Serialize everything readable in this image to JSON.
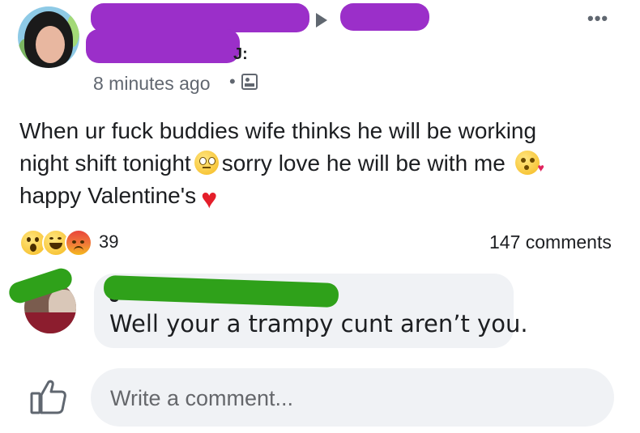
{
  "post": {
    "author_initial": "J:",
    "timestamp": "8 minutes ago",
    "separator": "•",
    "audience_icon": "friends-icon",
    "more_icon": "ellipsis-icon",
    "more_label": "•••",
    "text_line1": "When ur fuck buddies wife thinks he will be working",
    "text_line2a": "night shift tonight",
    "text_line2b": "sorry love he will be with me",
    "text_line3": "happy Valentine's",
    "heart": "♥"
  },
  "reactions": {
    "types": [
      "wow",
      "haha",
      "angry"
    ],
    "count": "39",
    "comments": "147 comments"
  },
  "comment": {
    "author_initial": "J",
    "text": "Well your a trampy cunt aren’t you."
  },
  "composer": {
    "placeholder": "Write a comment...",
    "like_icon": "thumbs-up-icon"
  }
}
